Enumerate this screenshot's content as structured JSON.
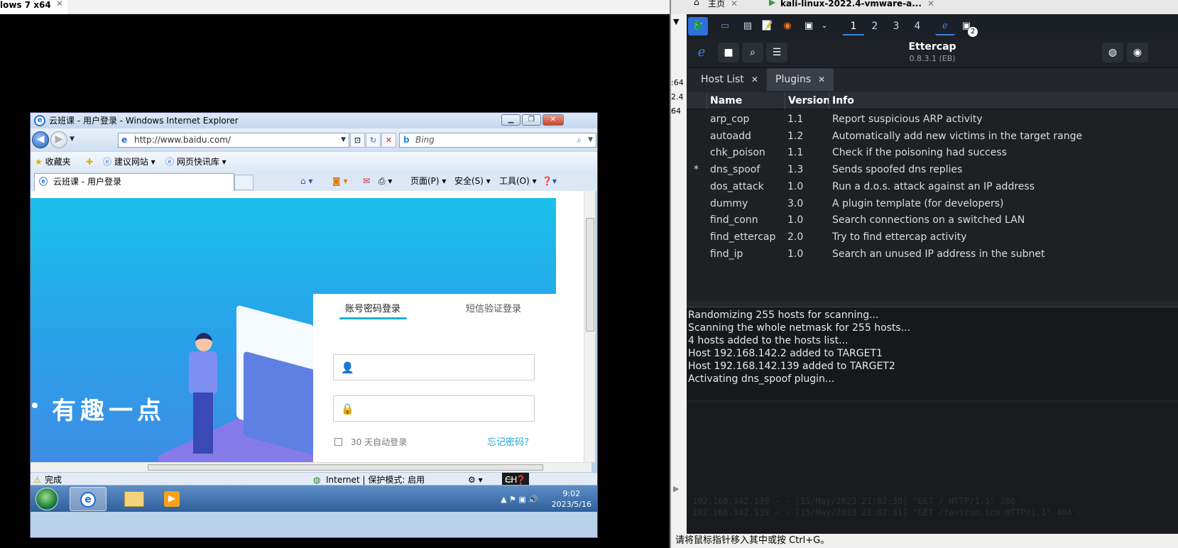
{
  "left_vm": {
    "tab_title": "lows 7 x64",
    "ie": {
      "window_title": "云班课 - 用户登录 - Windows Internet Explorer",
      "address": "http://www.baidu.com/",
      "search_placeholder": "Bing",
      "favorites_label": "收藏夹",
      "suggested_sites": "建议网站 ▾",
      "web_slice": "网页快讯库 ▾",
      "tab_title": "云班课 - 用户登录",
      "cmd_page": "页面(P) ▾",
      "cmd_safety": "安全(S) ▾",
      "cmd_tools": "工具(O) ▾",
      "page": {
        "hero_text": "有趣一点",
        "tab_account": "账号密码登录",
        "tab_sms": "短信验证登录",
        "remember": "30 天自动登录",
        "forgot": "忘记密码？"
      },
      "status_left": "完成",
      "status_zone": "Internet | 保护模式: 启用",
      "lang": "CH"
    },
    "taskbar": {
      "time": "9:02",
      "date": "2023/5/16"
    }
  },
  "right_vm": {
    "tab_home": "主页",
    "tab_kali": "kali-linux-2022.4-vmware-a...",
    "strip_fragments": [
      ":64",
      "2.4",
      "64"
    ],
    "workspaces": [
      "1",
      "2",
      "3",
      "4"
    ],
    "badge": "2",
    "ettercap": {
      "title": "Ettercap",
      "version": "0.8.3.1 (EB)",
      "tabs": [
        "Host List",
        "Plugins"
      ],
      "columns": [
        "Name",
        "Version",
        "Info"
      ],
      "plugins": [
        {
          "mark": "",
          "name": "arp_cop",
          "version": "1.1",
          "info": "Report suspicious ARP activity"
        },
        {
          "mark": "",
          "name": "autoadd",
          "version": "1.2",
          "info": "Automatically add new victims in the target range"
        },
        {
          "mark": "",
          "name": "chk_poison",
          "version": "1.1",
          "info": "Check if the poisoning had success"
        },
        {
          "mark": "*",
          "name": "dns_spoof",
          "version": "1.3",
          "info": "Sends spoofed dns replies"
        },
        {
          "mark": "",
          "name": "dos_attack",
          "version": "1.0",
          "info": "Run a d.o.s. attack against an IP address"
        },
        {
          "mark": "",
          "name": "dummy",
          "version": "3.0",
          "info": "A plugin template (for developers)"
        },
        {
          "mark": "",
          "name": "find_conn",
          "version": "1.0",
          "info": "Search connections on a switched LAN"
        },
        {
          "mark": "",
          "name": "find_ettercap",
          "version": "2.0",
          "info": "Try to find ettercap activity"
        },
        {
          "mark": "",
          "name": "find_ip",
          "version": "1.0",
          "info": "Search an unused IP address in the subnet"
        }
      ],
      "log": [
        "Randomizing 255 hosts for scanning...",
        "Scanning the whole netmask for 255 hosts...",
        "4 hosts added to the hosts list...",
        "Host 192.168.142.2 added to TARGET1",
        "Host 192.168.142.139 added to TARGET2",
        "Activating dns_spoof plugin..."
      ],
      "term_lines": [
        "192.168.142.139 - - [15/May/2023 21:02:30] \"GET / HTTP/1.1\" 200 -",
        "192.168.142.139 - - [15/May/2023 21:02:31] \"GET /favicon.ico HTTP/1.1\" 404 -"
      ]
    },
    "status_hint": "请将鼠标指针移入其中或按 Ctrl+G。"
  }
}
